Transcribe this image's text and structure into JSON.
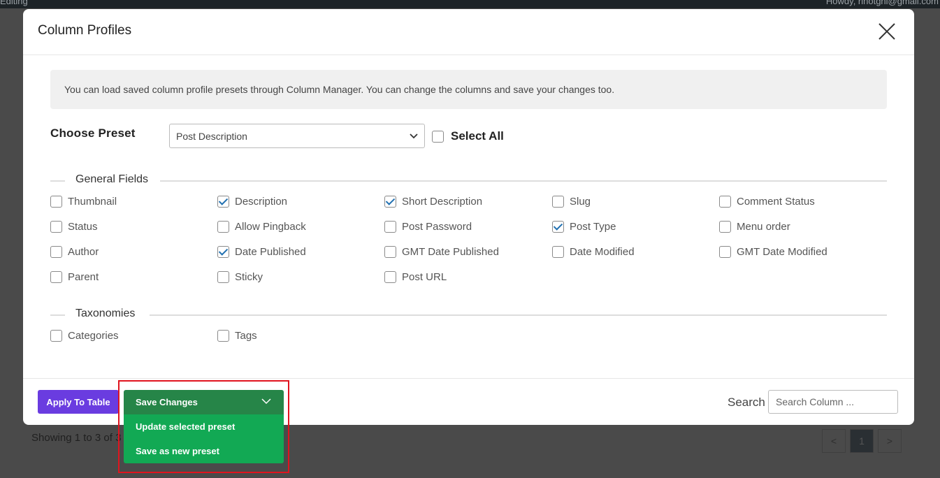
{
  "background": {
    "topbar_left": "Editing",
    "topbar_right": "Howdy, rinotgni@gmail.com",
    "showing_text": "Showing 1 to 3 of 3",
    "pager": {
      "prev": "<",
      "page": "1",
      "next": ">"
    }
  },
  "modal": {
    "title": "Column Profiles",
    "info_text": "You can load saved column profile presets through Column Manager. You can change the columns and save your changes too.",
    "choose_preset_label": "Choose Preset",
    "preset_value": "Post Description",
    "select_all_label": "Select All",
    "sections": {
      "general": {
        "title": "General Fields",
        "fields": [
          {
            "label": "Thumbnail",
            "checked": false
          },
          {
            "label": "Description",
            "checked": true
          },
          {
            "label": "Short Description",
            "checked": true
          },
          {
            "label": "Slug",
            "checked": false
          },
          {
            "label": "Comment Status",
            "checked": false
          },
          {
            "label": "Status",
            "checked": false
          },
          {
            "label": "Allow Pingback",
            "checked": false
          },
          {
            "label": "Post Password",
            "checked": false
          },
          {
            "label": "Post Type",
            "checked": true
          },
          {
            "label": "Menu order",
            "checked": false
          },
          {
            "label": "Author",
            "checked": false
          },
          {
            "label": "Date Published",
            "checked": true
          },
          {
            "label": "GMT Date Published",
            "checked": false
          },
          {
            "label": "Date Modified",
            "checked": false
          },
          {
            "label": "GMT Date Modified",
            "checked": false
          },
          {
            "label": "Parent",
            "checked": false
          },
          {
            "label": "Sticky",
            "checked": false
          },
          {
            "label": "Post URL",
            "checked": false
          }
        ]
      },
      "taxonomies": {
        "title": "Taxonomies",
        "fields": [
          {
            "label": "Categories",
            "checked": false
          },
          {
            "label": "Tags",
            "checked": false
          }
        ]
      }
    },
    "footer": {
      "apply_label": "Apply To Table",
      "save_changes_label": "Save Changes",
      "menu_items": [
        "Update selected preset",
        "Save as new preset"
      ],
      "search_label": "Search",
      "search_placeholder": "Search Column ..."
    }
  },
  "colors": {
    "apply_button": "#6a3ce0",
    "save_header": "#268548",
    "save_menu": "#12a954",
    "highlight_border": "#e0141e",
    "checkmark": "#2271b1"
  }
}
